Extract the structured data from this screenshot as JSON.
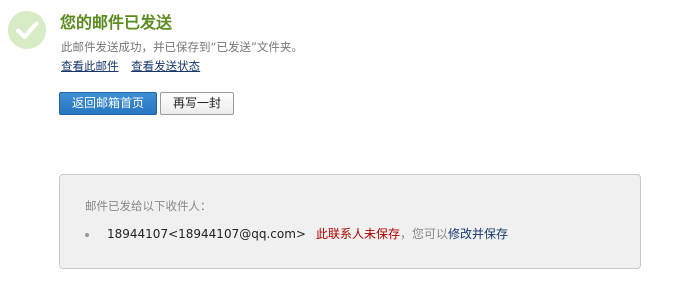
{
  "status": {
    "icon": "check-circle-icon",
    "title": "您的邮件已发送",
    "message": "此邮件发送成功，并已保存到“已发送”文件夹。",
    "links": {
      "view_mail": "查看此邮件",
      "view_status": "查看发送状态"
    }
  },
  "actions": {
    "back_label": "返回邮箱首页",
    "compose_label": "再写一封"
  },
  "recipients": {
    "heading": "邮件已发给以下收件人：",
    "items": [
      {
        "address": "18944107<18944107@qq.com>",
        "not_saved_text": "此联系人未保存",
        "separator_text": "，您可以",
        "save_link": "修改并保存"
      }
    ]
  },
  "colors": {
    "title_green": "#5a8c1e",
    "icon_bg": "#d7ebc4",
    "link_blue": "#16386b",
    "primary_button": "#2676c1",
    "warning_red": "#b00000"
  }
}
